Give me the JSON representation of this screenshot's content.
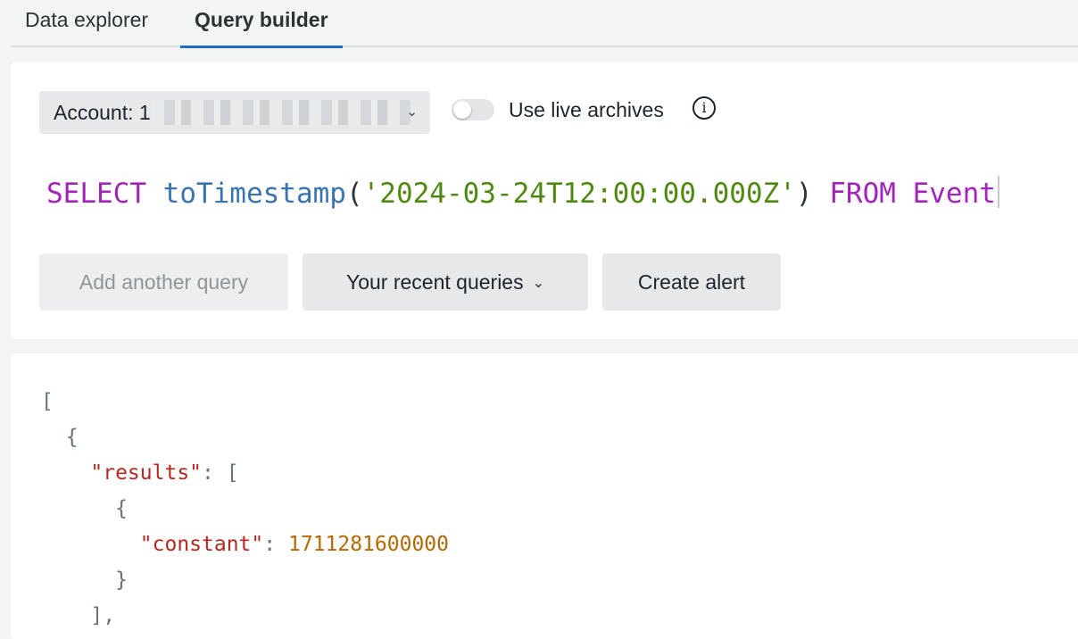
{
  "tabs": [
    {
      "label": "Data explorer",
      "active": false
    },
    {
      "label": "Query builder",
      "active": true
    }
  ],
  "account": {
    "label": "Account: ",
    "redacted_prefix": "1",
    "caret": "⌄"
  },
  "live_archives": {
    "label": "Use live archives",
    "enabled": false,
    "info_glyph": "i"
  },
  "query": {
    "tokens": {
      "select": "SELECT",
      "fn": "toTimestamp",
      "open": "(",
      "string": "'2024-03-24T12:00:00.000Z'",
      "close": ")",
      "from": "FROM",
      "table": "Event"
    }
  },
  "buttons": {
    "add_query": "Add another query",
    "recent_queries": "Your recent queries",
    "recent_chevron": "⌄",
    "create_alert": "Create alert"
  },
  "results": {
    "open_bracket": "[",
    "open_brace": "{",
    "results_key": "\"results\"",
    "results_open": "[",
    "inner_open": "{",
    "constant_key": "\"constant\"",
    "constant_value": "1711281600000",
    "inner_close": "}",
    "results_close": "],"
  },
  "colors": {
    "keyword": "#a324b8",
    "function": "#3a74b0",
    "string": "#4f8a10",
    "json_key": "#b5281f",
    "json_number": "#b26a00",
    "tab_underline": "#1f6ccc"
  },
  "icons": {
    "info": "info-icon",
    "account_caret": "chevron-down-icon",
    "recent_chevron": "chevron-down-icon"
  }
}
